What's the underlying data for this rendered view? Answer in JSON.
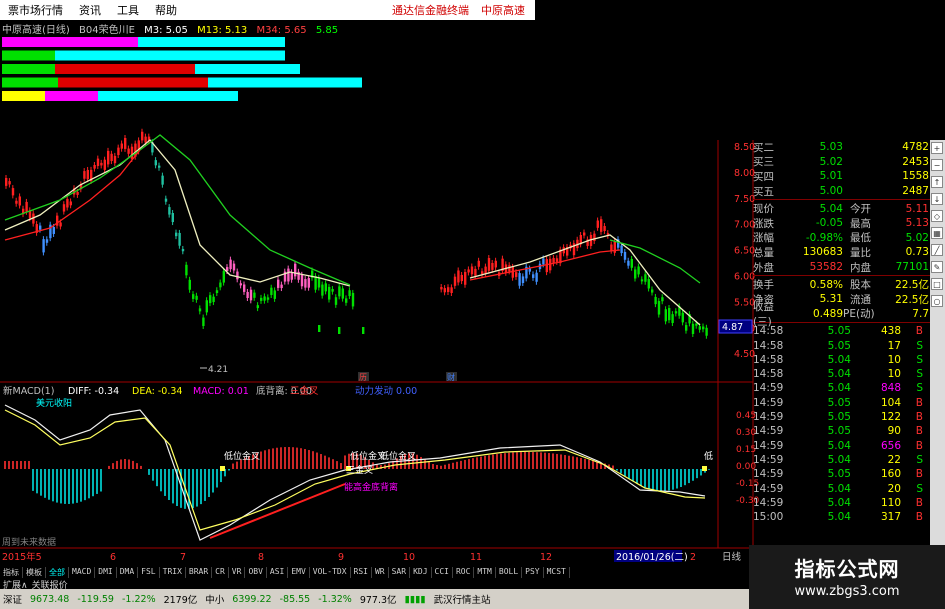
{
  "menu": {
    "items": [
      "票市场行情",
      "资讯",
      "工具",
      "帮助"
    ],
    "right1": "通达信金融终端",
    "right2": "中原高速"
  },
  "title": {
    "name": "中原高速(日线)",
    "formula": "B04荣色川E",
    "m3": "M3: 5.05",
    "m13": "M13: 5.13",
    "m34": "M34: 5.65",
    "m5": "5.85"
  },
  "indicator": {
    "name": "新MACD(1)",
    "diff": "DIFF: -0.34",
    "dea": "DEA: -0.34",
    "macd": "MACD: 0.01",
    "bottom": "底背离: 0.00",
    "sanjin": "三金叉",
    "dangan": "动力发动 0.00"
  },
  "price_axis": [
    "8.50",
    "8.00",
    "7.50",
    "7.00",
    "6.50",
    "6.00",
    "5.50",
    "5.00",
    "4.50"
  ],
  "macd_axis": [
    "0.45",
    "0.30",
    "0.15",
    "0.00",
    "-0.15",
    "-0.30"
  ],
  "current_price_label": "4.87",
  "low_label": "4.21",
  "marks": {
    "m1": "历",
    "m2": "财"
  },
  "annotations": {
    "a1": "美元收阳",
    "a2": "低位金叉",
    "a3": "低位金叉",
    "a4": "低位金叉",
    "a5": "三金叉",
    "a6": "能高金底背离",
    "a7": "低",
    "b1": "周到未来数据"
  },
  "xaxis": {
    "labels": [
      "2015年5",
      "6",
      "7",
      "8",
      "9",
      "10",
      "11",
      "12",
      "2",
      "日线"
    ],
    "date": "2016/01/26(二)"
  },
  "quotes": [
    {
      "label": "买二",
      "value": "5.03",
      "vol": "4782"
    },
    {
      "label": "买三",
      "value": "5.02",
      "vol": "2453"
    },
    {
      "label": "买四",
      "value": "5.01",
      "vol": "1558"
    },
    {
      "label": "买五",
      "value": "5.00",
      "vol": "2487"
    }
  ],
  "stats": [
    {
      "l1": "现价",
      "v1": "5.04",
      "l2": "今开",
      "v2": "5.11"
    },
    {
      "l1": "涨跌",
      "v1": "-0.05",
      "l2": "最高",
      "v2": "5.13"
    },
    {
      "l1": "涨幅",
      "v1": "-0.98%",
      "l2": "最低",
      "v2": "5.02"
    },
    {
      "l1": "总量",
      "v1": "130683",
      "l2": "量比",
      "v2": "0.73"
    },
    {
      "l1": "外盘",
      "v1": "53582",
      "l2": "内盘",
      "v2": "77101"
    }
  ],
  "stats2": [
    {
      "l1": "换手",
      "v1": "0.58%",
      "l2": "股本",
      "v2": "22.5亿"
    },
    {
      "l1": "净资",
      "v1": "5.31",
      "l2": "流通",
      "v2": "22.5亿"
    },
    {
      "l1": "收益(三)",
      "v1": "0.489",
      "l2": "PE(动)",
      "v2": "7.7"
    }
  ],
  "ticks": [
    {
      "t": "14:58",
      "p": "5.05",
      "q": "438",
      "s": "B"
    },
    {
      "t": "14:58",
      "p": "5.05",
      "q": "17",
      "s": "S"
    },
    {
      "t": "14:58",
      "p": "5.04",
      "q": "10",
      "s": "S"
    },
    {
      "t": "14:58",
      "p": "5.04",
      "q": "10",
      "s": "S"
    },
    {
      "t": "14:59",
      "p": "5.04",
      "q": "848",
      "s": "S"
    },
    {
      "t": "14:59",
      "p": "5.05",
      "q": "104",
      "s": "B"
    },
    {
      "t": "14:59",
      "p": "5.05",
      "q": "122",
      "s": "B"
    },
    {
      "t": "14:59",
      "p": "5.05",
      "q": "90",
      "s": "B"
    },
    {
      "t": "14:59",
      "p": "5.04",
      "q": "656",
      "s": "B"
    },
    {
      "t": "14:59",
      "p": "5.04",
      "q": "22",
      "s": "S"
    },
    {
      "t": "14:59",
      "p": "5.05",
      "q": "160",
      "s": "B"
    },
    {
      "t": "14:59",
      "p": "5.04",
      "q": "20",
      "s": "S"
    },
    {
      "t": "14:59",
      "p": "5.04",
      "q": "110",
      "s": "B"
    },
    {
      "t": "15:00",
      "p": "5.04",
      "q": "317",
      "s": "B"
    }
  ],
  "tabs": [
    "指标",
    "模板",
    "全部",
    "MACD",
    "DMI",
    "DMA",
    "FSL",
    "TRIX",
    "BRAR",
    "CR",
    "VR",
    "OBV",
    "ASI",
    "EMV",
    "VOL-TDX",
    "RSI",
    "WR",
    "SAR",
    "KDJ",
    "CCI",
    "ROC",
    "MTM",
    "BOLL",
    "PSY",
    "MCST"
  ],
  "tabs_row2": [
    "扩展∧",
    "关联报价"
  ],
  "status": {
    "sh": "深证",
    "sh_val": "9673.48",
    "sh_chg": "-119.59",
    "sh_pct": "-1.22%",
    "sh_amt": "2179亿",
    "zx": "中小",
    "zx_val": "6399.22",
    "zx_chg": "-85.55",
    "zx_pct": "-1.32%",
    "zx_amt": "977.3亿",
    "site": "武汉行情主站"
  },
  "watermark": {
    "line1": "指标公式网",
    "line2": "www.zbgs3.com"
  },
  "colors": {
    "up": "#ff2020",
    "down": "#00e000",
    "cyan": "#00ffff",
    "magenta": "#ff00ff",
    "yellow": "#ffff00",
    "grid": "#800000"
  }
}
